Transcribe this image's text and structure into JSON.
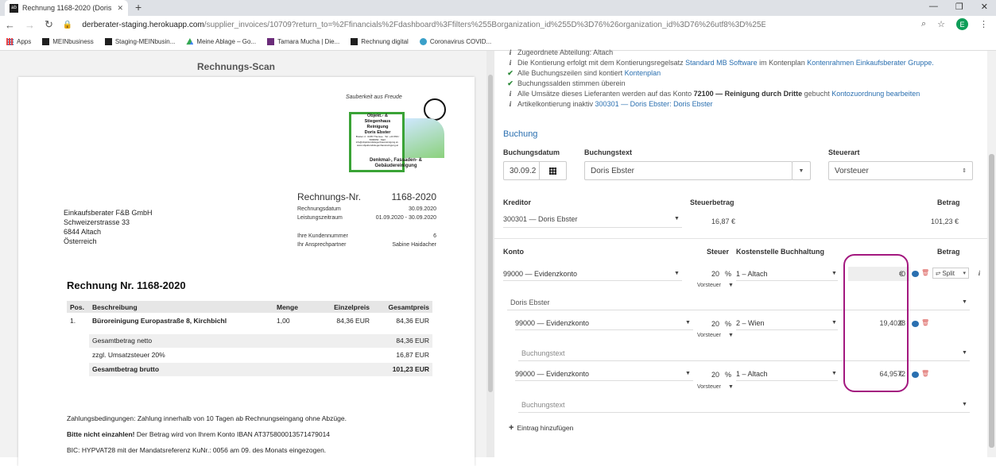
{
  "browser": {
    "tab_title": "Rechnung 1168-2020 (Doris Ebster",
    "url_host": "derberater-staging.herokuapp.com",
    "url_path": "/supplier_invoices/10709?return_to=%2Ffinancials%2Fdashboard%3Ffilters%255Borganization_id%255D%3D76%26organization_id%3D76%26utf8%3D%25E2%259C%2593#",
    "avatar_letter": "E",
    "bookmarks": [
      "Apps",
      "MEINbusiness",
      "Staging-MEINbusin...",
      "Meine Ablage – Go...",
      "Tamara Mucha | Die...",
      "Rechnung digital",
      "Coronavirus COVID..."
    ]
  },
  "scan": {
    "title": "Rechnungs-Scan",
    "logo": {
      "arc_text": "Sauberkeit aus Freude",
      "line1": "Objekt.- &",
      "line2": "Stiegenhaus",
      "line3": "Reinigung",
      "line4": "Doris Ebster",
      "small": "Breiten 4 · 6235 Thiersee · Tel: +43 650 / 5696654 · Mail: info@objektundstiegenhausreinigung.at · www.objektundstiegenhausreinigung.at",
      "line5": "Denkmal-, Fassaden- &",
      "line6": "Gebäudereinigung"
    },
    "invoice_no_label": "Rechnungs-Nr.",
    "invoice_no": "1168-2020",
    "meta": [
      {
        "k": "Rechnungsdatum",
        "v": "30.09.2020"
      },
      {
        "k": "Leistungszeitraum",
        "v": "01.09.2020 - 30.09.2020"
      },
      {
        "k": "Ihre Kundennummer",
        "v": "6"
      },
      {
        "k": "Ihr Ansprechpartner",
        "v": "Sabine Haidacher"
      }
    ],
    "address": [
      "Einkaufsberater F&B GmbH",
      "Schweizerstrasse 33",
      "6844 Altach",
      "Österreich"
    ],
    "heading": "Rechnung Nr. 1168-2020",
    "table_headers": [
      "Pos.",
      "Beschreibung",
      "Menge",
      "Einzelpreis",
      "Gesamtpreis"
    ],
    "item": {
      "pos": "1.",
      "desc": "Büroreinigung Europastraße 8, Kirchbichl",
      "qty": "1,00",
      "unit": "84,36 EUR",
      "total": "84,36 EUR"
    },
    "sums": [
      {
        "label": "Gesamtbetrag netto",
        "value": "84,36 EUR"
      },
      {
        "label": "zzgl. Umsatzsteuer 20%",
        "value": "16,87 EUR"
      },
      {
        "label": "Gesamtbetrag brutto",
        "value": "101,23 EUR"
      }
    ],
    "terms1": "Zahlungsbedingungen: Zahlung innerhalb von 10 Tagen ab Rechnungseingang ohne Abzüge.",
    "terms2_bold": "Bitte nicht einzahlen!",
    "terms2_rest": " Der Betrag wird von Ihrem Konto IBAN AT375800013571479014",
    "terms3": "BIC: HYPVAT28 mit der Mandatsreferenz KuNr.: 0056 am 09. des Monats eingezogen."
  },
  "checks": {
    "l1": "Zugeordnete Abteilung: Altach",
    "l2a": "Die Kontierung erfolgt mit dem Kontierungsregelsatz ",
    "l2b": "Standard MB Software",
    "l2c": " im Kontenplan ",
    "l2d": "Kontenrahmen Einkaufsberater Gruppe.",
    "l3a": "Alle Buchungszeilen sind kontiert ",
    "l3b": "Kontenplan",
    "l4": "Buchungssalden stimmen überein",
    "l5a": "Alle Umsätze dieses Lieferanten werden auf das Konto ",
    "l5b": "72100 — Reinigung durch Dritte",
    "l5c": " gebucht ",
    "l5d": "Kontozuordnung bearbeiten",
    "l6a": "Artikelkontierung inaktiv ",
    "l6b": "300301 — Doris Ebster: Doris Ebster"
  },
  "booking": {
    "section": "Buchung",
    "date_label": "Buchungsdatum",
    "date_value": "30.09.2",
    "text_label": "Buchungstext",
    "text_value": "Doris Ebster",
    "tax_label": "Steuerart",
    "tax_value": "Vorsteuer",
    "kreditor_label": "Kreditor",
    "kreditor_value": "300301 — Doris Ebster",
    "steuerbetrag_label": "Steuerbetrag",
    "steuerbetrag_value": "16,87 €",
    "betrag_label": "Betrag",
    "betrag_value": "101,23 €"
  },
  "lines": {
    "h_konto": "Konto",
    "h_steuer": "Steuer",
    "h_kst": "Kostenstelle Buchhaltung",
    "h_betrag": "Betrag",
    "row1": {
      "konto": "99000 — Evidenzkonto",
      "pct": "20",
      "kst": "1 – Altach",
      "amount": "0",
      "tax": "Vorsteuer"
    },
    "split": "Split",
    "group_text": "Doris Ebster",
    "row2": {
      "konto": "99000 — Evidenzkonto",
      "pct": "20",
      "kst": "2 – Wien",
      "amount": "19,4028",
      "tax": "Vorsteuer"
    },
    "buchungstext1": "Buchungstext",
    "row3": {
      "konto": "99000 — Evidenzkonto",
      "pct": "20",
      "kst": "1 – Altach",
      "amount": "64,9572",
      "tax": "Vorsteuer"
    },
    "buchungstext2": "Buchungstext",
    "add_entry": "Eintrag hinzufügen",
    "percent": "%",
    "euro": "€"
  },
  "colors": {
    "accent": "#2a6fb0",
    "highlight": "#a3187f",
    "ok": "#2e8b3a"
  }
}
